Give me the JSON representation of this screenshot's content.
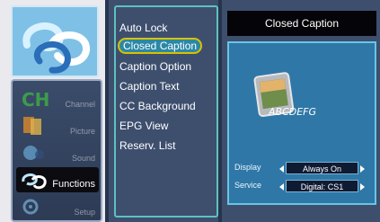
{
  "sidebar": {
    "items": [
      {
        "label": "Channel",
        "icon": "channel-icon"
      },
      {
        "label": "Picture",
        "icon": "picture-icon"
      },
      {
        "label": "Sound",
        "icon": "sound-icon"
      },
      {
        "label": "Functions",
        "icon": "functions-icon",
        "active": true
      },
      {
        "label": "Setup",
        "icon": "setup-icon"
      }
    ]
  },
  "menu": {
    "items": [
      "Auto Lock",
      "Closed Caption",
      "Caption Option",
      "Caption Text",
      "CC Background",
      "EPG View",
      "Reserv. List"
    ],
    "selected_index": 1
  },
  "panel": {
    "title": "Closed Caption",
    "preview_text": "ABCDEFG",
    "settings": [
      {
        "label": "Display",
        "value": "Always On"
      },
      {
        "label": "Service",
        "value": "Digital: CS1"
      }
    ]
  },
  "colors": {
    "background": "#3e4f6e",
    "highlight_border": "#d9c200",
    "highlight_fill": "#2b88a6",
    "preview_fill": "#2f77a7"
  }
}
